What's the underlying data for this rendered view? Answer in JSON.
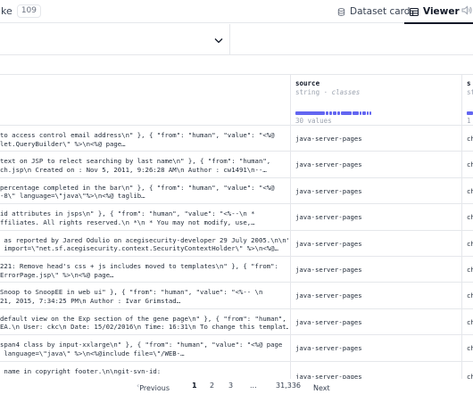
{
  "header": {
    "like_label": "ike",
    "like_count": "109",
    "tabs": [
      {
        "label": "Dataset card",
        "icon": "dataset-card-icon"
      },
      {
        "label": "Viewer",
        "icon": "viewer-table-icon",
        "active": true
      }
    ]
  },
  "columns": [
    {
      "title": "source",
      "type": "string",
      "type_detail": "classes",
      "summary": "30 values"
    },
    {
      "title": "s",
      "type": "st",
      "summary": "1"
    }
  ],
  "rows": [
    {
      "line1": "to access control email address\\n\" }, { \"from\": \"human\", \"value\": \"<%@",
      "line2": "let.QueryBuilder\\\" %>\\n<%@ page…",
      "source": "java-server-pages",
      "third": "ch"
    },
    {
      "line1": "text on JSP to relect searching by last name\\n\" }, { \"from\": \"human\",",
      "line2": "ch.jsp\\n Created on : Nov 5, 2011, 9:26:28 AM\\n Author : cw1491\\n--…",
      "source": "java-server-pages",
      "third": "ch"
    },
    {
      "line1": "percentage completed in the bar\\n\" }, { \"from\": \"human\", \"value\": \"<%@",
      "line2": "-8\\\" language=\\\"java\\\"%>\\n<%@ taglib…",
      "source": "java-server-pages",
      "third": "ch"
    },
    {
      "line1": "id attributes in jsps\\n\" }, { \"from\": \"human\", \"value\": \"<%--\\n *",
      "line2": "ffiliates. All rights reserved.\\n *\\n * You may not modify, use,…",
      "source": "java-server-pages",
      "third": "ch"
    },
    {
      "line1": " as reported by Jared Odulio on acegisecurity-developer 29 July 2005.\\n\\n\"",
      "line2": " import=\\\"net.sf.acegisecurity.context.SecurityContextHolder\\\" %>\\n<%@…",
      "source": "java-server-pages",
      "third": "ch"
    },
    {
      "line1": "221: Remove head's css + js includes moved to templates\\n\" }, { \"from\":",
      "line2": "ErrorPage.jsp\\\" %>\\n<%@ page…",
      "source": "java-server-pages",
      "third": "ch"
    },
    {
      "line1": "Snoop to SnoopEE in web ui\" }, { \"from\": \"human\", \"value\": \"<%-- \\n",
      "line2": "21, 2015, 7:34:25 PM\\n Author : Ivar Grimstad…",
      "source": "java-server-pages",
      "third": "ch"
    },
    {
      "line1": "default view on the Exp section of the gene page\\n\" }, { \"from\": \"human\",",
      "line2": "EA.\\n User: ckc\\n Date: 15/02/2016\\n Time: 16:31\\n To change this templat…",
      "source": "java-server-pages",
      "third": "ch"
    },
    {
      "line1": "span4 class by input-xxlarge\\n\" }, { \"from\": \"human\", \"value\": \"<%@ page",
      "line2": " language=\\\"java\\\" %>\\n<%@include file=\\\"/WEB-…",
      "source": "java-server-pages",
      "third": "ch"
    },
    {
      "line1": " name in copyright footer.\\n\\ngit-svn-id:",
      "line2": "",
      "source": "java-server-pages",
      "third": "ch"
    }
  ],
  "pagination": {
    "previous": "Previous",
    "pages": [
      "1",
      "2",
      "3",
      "...",
      "31,336"
    ],
    "current": "1",
    "next": "Next"
  },
  "colors": {
    "accent": "#6366f1",
    "border": "#e5e7eb"
  }
}
